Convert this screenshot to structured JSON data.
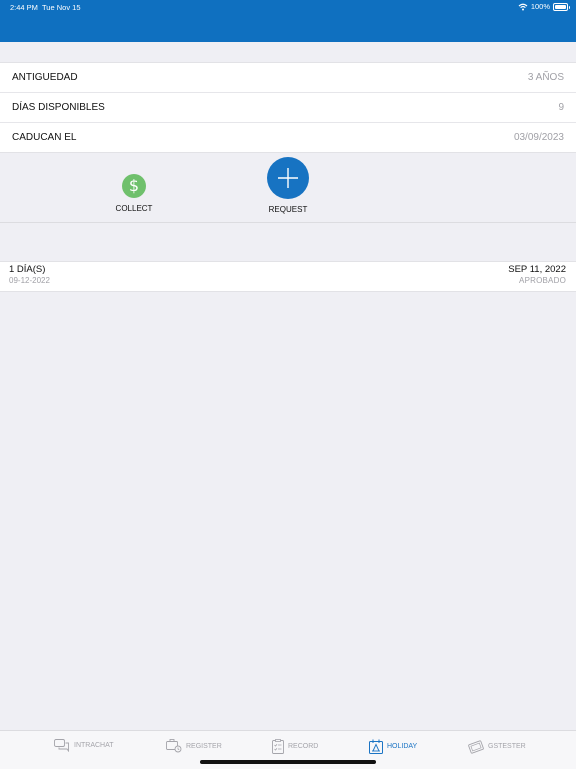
{
  "status_bar": {
    "time": "2:44 PM",
    "date": "Tue Nov 15",
    "battery": "100%"
  },
  "info": [
    {
      "label": "ANTIGUEDAD",
      "value": "3 AÑOS"
    },
    {
      "label": "DÍAS DISPONIBLES",
      "value": "9"
    },
    {
      "label": "CADUCAN EL",
      "value": "03/09/2023"
    }
  ],
  "actions": {
    "collect": {
      "label": "COLLECT",
      "icon": "dollar-icon",
      "color": "#6fc06c"
    },
    "request": {
      "label": "REQUEST",
      "icon": "plus-icon",
      "color": "#1773c2"
    }
  },
  "history": [
    {
      "days": "1 DÍA(S)",
      "date_requested": "09-12-2022",
      "start": "SEP 11, 2022",
      "status": "APROBADO"
    }
  ],
  "tabs": [
    {
      "label": "INTRACHAT",
      "icon": "chat-icon",
      "active": false
    },
    {
      "label": "REGISTER",
      "icon": "register-icon",
      "active": false
    },
    {
      "label": "RECORD",
      "icon": "clipboard-icon",
      "active": false
    },
    {
      "label": "HOLIDAY",
      "icon": "holiday-icon",
      "active": true
    },
    {
      "label": "GSTESTER",
      "icon": "ticket-icon",
      "active": false
    }
  ],
  "colors": {
    "header": "#0f70c0",
    "accent": "#1b74c4",
    "background": "#efeff4"
  }
}
